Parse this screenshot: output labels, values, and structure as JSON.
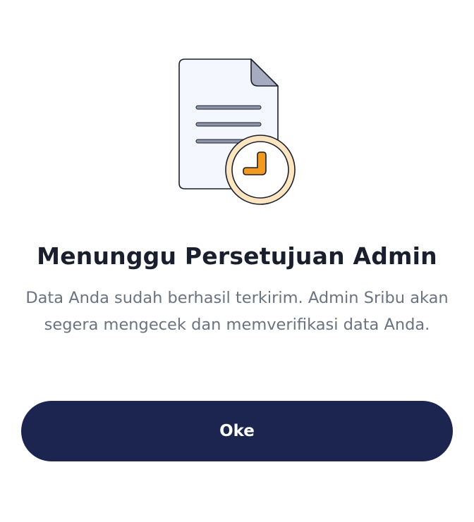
{
  "dialog": {
    "illustration_icon": "pending-document-clock-icon",
    "title": "Menunggu Persetujuan Admin",
    "message": "Data Anda sudah berhasil terkirim. Admin Sribu akan segera mengecek dan memverifikasi data Anda.",
    "ok_label": "Oke"
  },
  "colors": {
    "button_bg": "#1b2550",
    "title_text": "#1a1f2e",
    "body_text": "#6b7280",
    "clock_accent": "#f29a1f",
    "clock_ring": "#fde6bf"
  }
}
